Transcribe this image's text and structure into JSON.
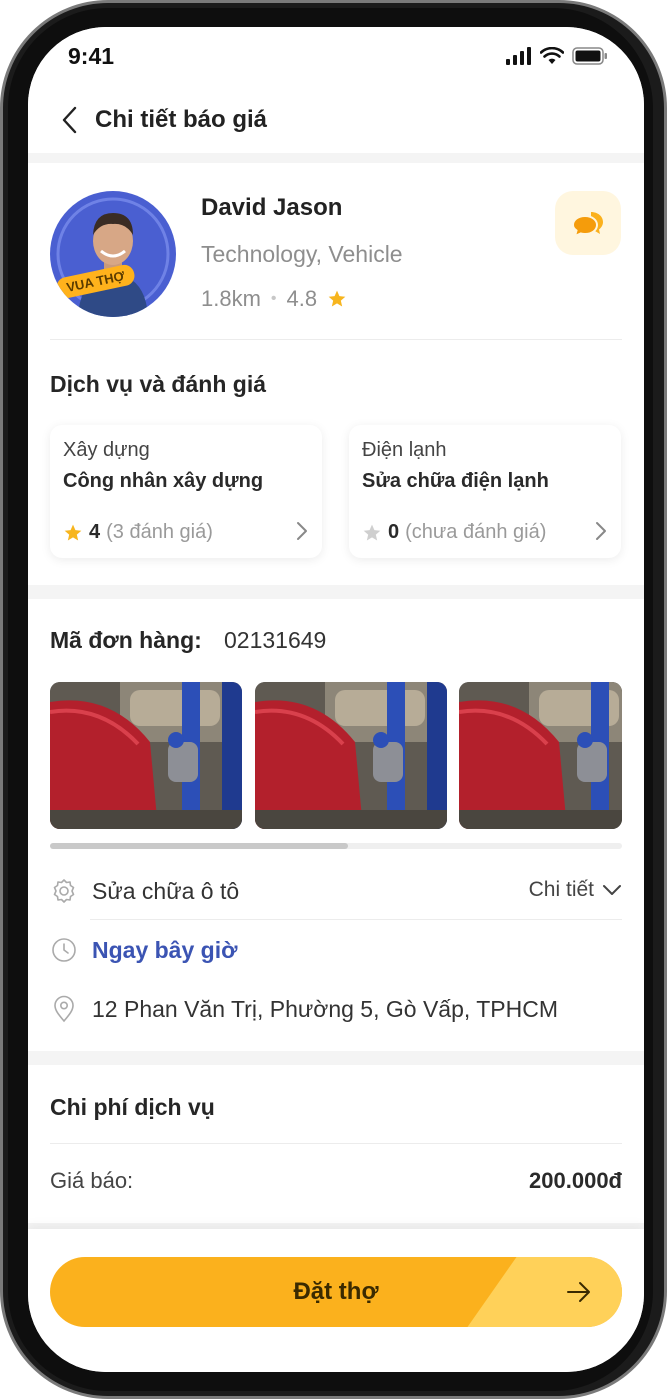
{
  "status_bar": {
    "time": "9:41"
  },
  "header": {
    "title": "Chi tiết báo giá"
  },
  "provider": {
    "name": "David Jason",
    "category": "Technology, Vehicle",
    "distance": "1.8km",
    "separator": "•",
    "rating": "4.8",
    "badge": "VUA THỢ"
  },
  "services": {
    "title": "Dịch vụ và đánh giá",
    "items": [
      {
        "type": "Xây dựng",
        "name": "Công nhân xây dựng",
        "rating": "4",
        "reviews": "(3 đánh giá)",
        "star_color": "#f7b51e"
      },
      {
        "type": "Điện lạnh",
        "name": "Sửa chữa điện lạnh",
        "rating": "0",
        "reviews": "(chưa đánh giá)",
        "star_color": "#cfcfcf"
      }
    ]
  },
  "order": {
    "label": "Mã đơn hàng:",
    "code": "02131649",
    "service": "Sửa chữa ô tô",
    "detail_label": "Chi tiết",
    "time": "Ngay bây giờ",
    "address": "12 Phan Văn Trị, Phường 5, Gò Vấp, TPHCM"
  },
  "cost": {
    "title": "Chi phí dịch vụ",
    "quote_label": "Giá báo:",
    "quote_value": "200.000đ"
  },
  "footer": {
    "book_label": "Đặt thợ"
  },
  "colors": {
    "accent": "#fbb11d",
    "link": "#3b54b3"
  }
}
